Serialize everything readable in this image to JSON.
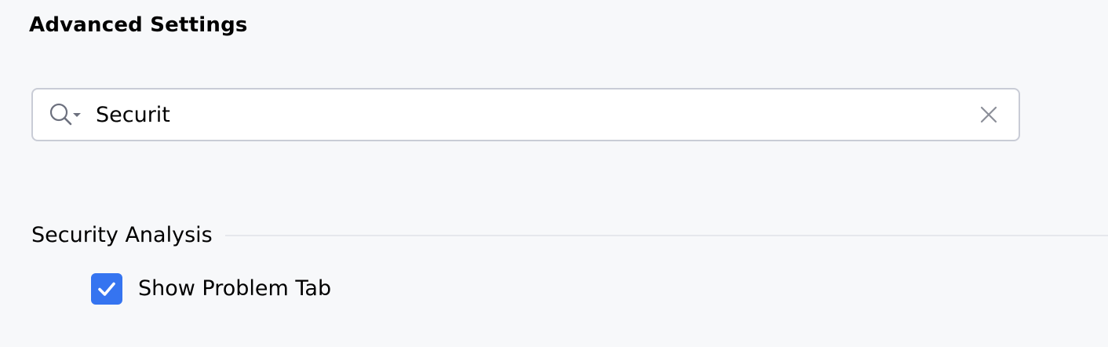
{
  "page": {
    "title": "Advanced Settings"
  },
  "search": {
    "value": "Securit",
    "icon": "search-with-history-dropdown-icon",
    "clear_icon": "close-icon"
  },
  "section": {
    "title": "Security Analysis"
  },
  "options": [
    {
      "label": "Show Problem Tab",
      "checked": true
    }
  ],
  "colors": {
    "background": "#f7f8fa",
    "accent": "#3574f0",
    "input_border": "#c9ccd6",
    "divider": "#e6e8ec"
  }
}
